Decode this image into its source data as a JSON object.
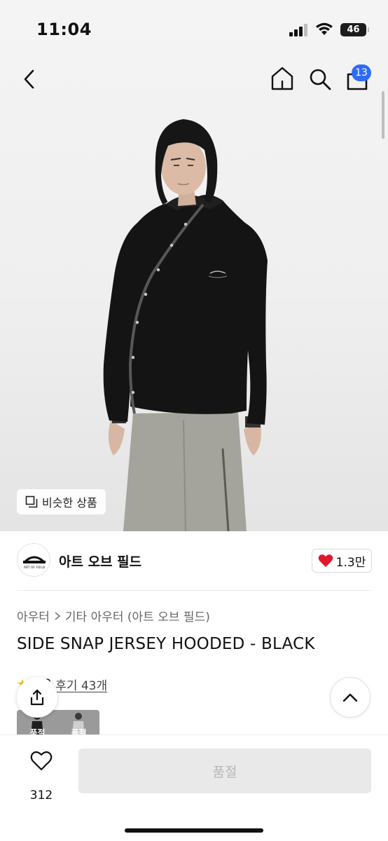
{
  "status_bar": {
    "time": "11:04",
    "battery": "46"
  },
  "nav": {
    "back_icon": "chevron-left-icon",
    "home_icon": "home-icon",
    "search_icon": "search-icon",
    "cart_icon": "cart-icon",
    "cart_count": "13"
  },
  "hero": {
    "similar_button_label": "비슷한 상품"
  },
  "brand": {
    "name": "아트 오브 필드",
    "logo_text": "ART OF FIELD",
    "likes": "1.3만"
  },
  "breadcrumb": {
    "level1": "아우터",
    "level2": "기타 아우터 (아트 오브 필드)"
  },
  "product": {
    "title": "SIDE SNAP JERSEY HOODED - BLACK",
    "rating": "5.0",
    "reviews_label": "후기 43개"
  },
  "variants": [
    {
      "label": "품절"
    },
    {
      "label": "품절"
    }
  ],
  "bottom": {
    "wish_count": "312",
    "buy_label": "품절"
  },
  "colors": {
    "accent_badge": "#2f6cf6",
    "like_heart": "#e0182d",
    "disabled_button": "#e9e9e9"
  }
}
